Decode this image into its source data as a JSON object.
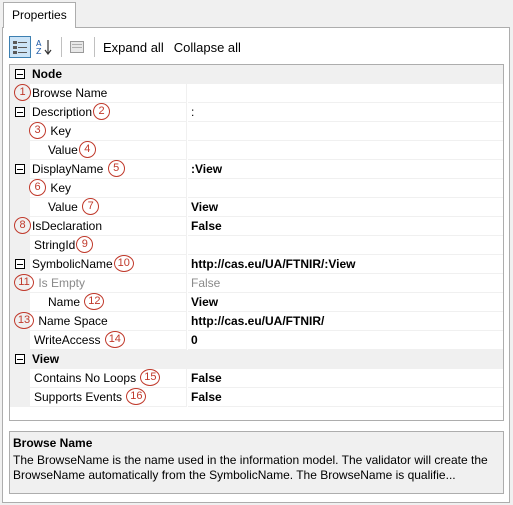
{
  "tab": {
    "label": "Properties"
  },
  "toolbar": {
    "categorized_icon": "categorized-icon",
    "alphabetical_icon": "sort-az-icon",
    "pages_icon": "property-pages-icon",
    "expand_all": "Expand all",
    "collapse_all": "Collapse all"
  },
  "grid": {
    "node": {
      "label": "Node"
    },
    "browse_name": {
      "badge": "1",
      "label": "Browse Name",
      "value": ""
    },
    "description": {
      "label": "Description",
      "badge": "2",
      "value": ":"
    },
    "description_key": {
      "badge": "3",
      "label": "Key",
      "value": ""
    },
    "description_value": {
      "label": "Value",
      "badge": "4",
      "value": ""
    },
    "display_name": {
      "label": "DisplayName",
      "badge": "5",
      "value": ":View"
    },
    "display_key": {
      "badge": "6",
      "label": "Key",
      "value": ""
    },
    "display_value": {
      "label": "Value",
      "badge": "7",
      "value": "View"
    },
    "is_declaration": {
      "badge": "8",
      "label": "IsDeclaration",
      "value": "False"
    },
    "string_id": {
      "label": "StringId",
      "badge": "9",
      "value": ""
    },
    "symbolic_name": {
      "label": "SymbolicName",
      "badge": "10",
      "value": "http://cas.eu/UA/FTNIR/:View"
    },
    "is_empty": {
      "badge": "11",
      "label": "Is Empty",
      "value": "False"
    },
    "name": {
      "label": "Name",
      "badge": "12",
      "value": "View"
    },
    "name_space": {
      "badge": "13",
      "label": "Name Space",
      "value": "http://cas.eu/UA/FTNIR/"
    },
    "write_access": {
      "label": "WriteAccess",
      "badge": "14",
      "value": "0"
    },
    "view": {
      "label": "View"
    },
    "contains_no_loops": {
      "label": "Contains No Loops",
      "badge": "15",
      "value": "False"
    },
    "supports_events": {
      "label": "Supports Events",
      "badge": "16",
      "value": "False"
    }
  },
  "help": {
    "title": "Browse Name",
    "description": "The BrowseName is the name used in the information model. The validator will create the BrowseName automatically from the SymbolicName. The BrowseName is qualifie..."
  },
  "colors": {
    "badge": "#c0392b",
    "selection": "#cce4f7",
    "border": "#adadad"
  }
}
